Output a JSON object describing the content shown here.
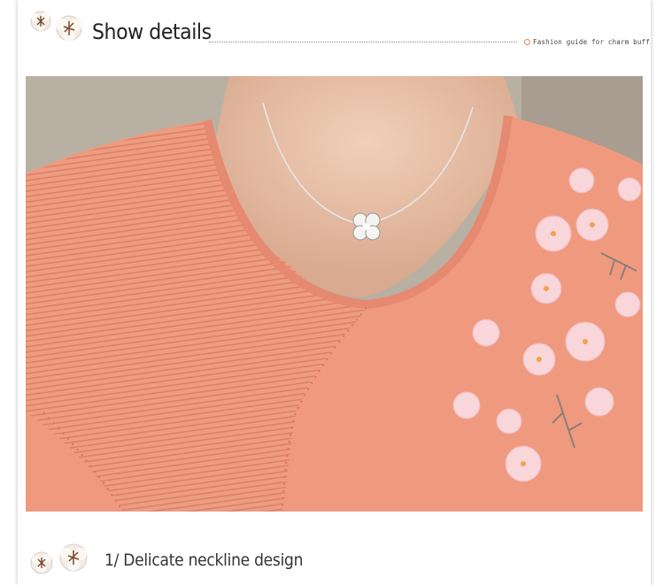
{
  "header": {
    "title": "Show details",
    "tagline": "Fashion guide for charm buff"
  },
  "section": {
    "caption": "1/ Delicate neckline design"
  },
  "icons": {
    "decor": "cotton-flower-icon",
    "tag_bullet": "circle-bullet-icon"
  },
  "colors": {
    "sweater": "#ef9a7e",
    "accent": "#e0874a",
    "skin": "#e9c3aa"
  }
}
